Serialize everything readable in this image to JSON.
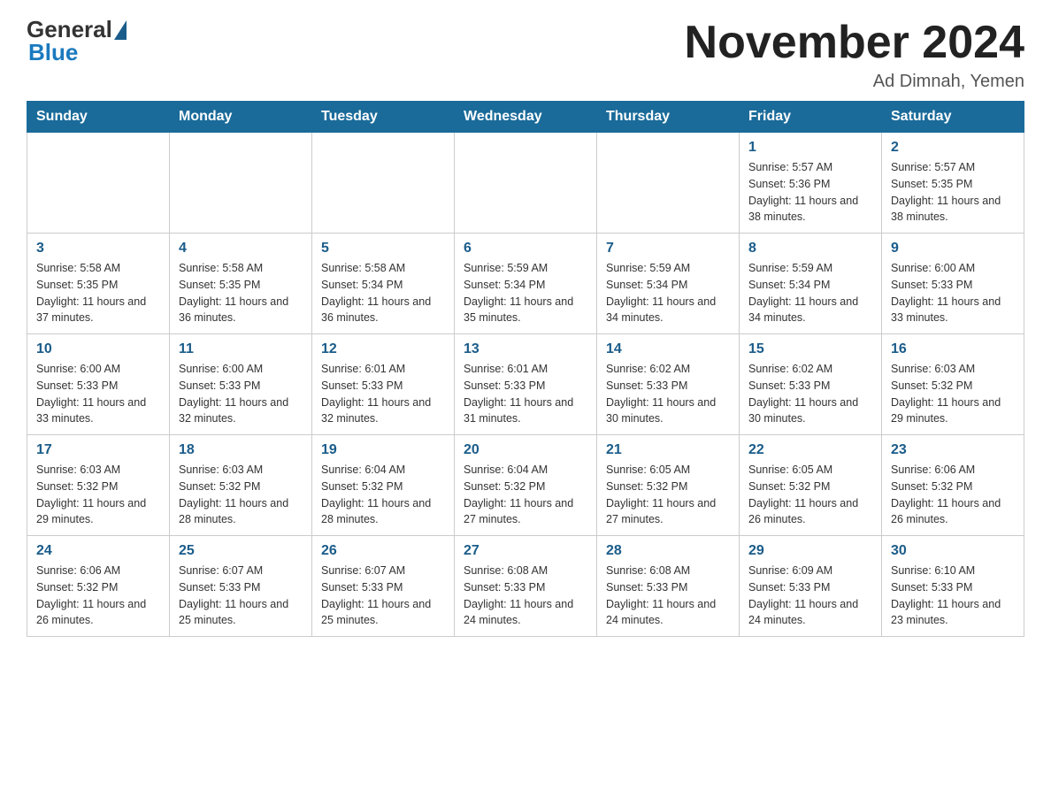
{
  "header": {
    "logo_general": "General",
    "logo_blue": "Blue",
    "month_title": "November 2024",
    "location": "Ad Dimnah, Yemen"
  },
  "weekdays": [
    "Sunday",
    "Monday",
    "Tuesday",
    "Wednesday",
    "Thursday",
    "Friday",
    "Saturday"
  ],
  "weeks": [
    [
      {
        "day": "",
        "info": ""
      },
      {
        "day": "",
        "info": ""
      },
      {
        "day": "",
        "info": ""
      },
      {
        "day": "",
        "info": ""
      },
      {
        "day": "",
        "info": ""
      },
      {
        "day": "1",
        "info": "Sunrise: 5:57 AM\nSunset: 5:36 PM\nDaylight: 11 hours and 38 minutes."
      },
      {
        "day": "2",
        "info": "Sunrise: 5:57 AM\nSunset: 5:35 PM\nDaylight: 11 hours and 38 minutes."
      }
    ],
    [
      {
        "day": "3",
        "info": "Sunrise: 5:58 AM\nSunset: 5:35 PM\nDaylight: 11 hours and 37 minutes."
      },
      {
        "day": "4",
        "info": "Sunrise: 5:58 AM\nSunset: 5:35 PM\nDaylight: 11 hours and 36 minutes."
      },
      {
        "day": "5",
        "info": "Sunrise: 5:58 AM\nSunset: 5:34 PM\nDaylight: 11 hours and 36 minutes."
      },
      {
        "day": "6",
        "info": "Sunrise: 5:59 AM\nSunset: 5:34 PM\nDaylight: 11 hours and 35 minutes."
      },
      {
        "day": "7",
        "info": "Sunrise: 5:59 AM\nSunset: 5:34 PM\nDaylight: 11 hours and 34 minutes."
      },
      {
        "day": "8",
        "info": "Sunrise: 5:59 AM\nSunset: 5:34 PM\nDaylight: 11 hours and 34 minutes."
      },
      {
        "day": "9",
        "info": "Sunrise: 6:00 AM\nSunset: 5:33 PM\nDaylight: 11 hours and 33 minutes."
      }
    ],
    [
      {
        "day": "10",
        "info": "Sunrise: 6:00 AM\nSunset: 5:33 PM\nDaylight: 11 hours and 33 minutes."
      },
      {
        "day": "11",
        "info": "Sunrise: 6:00 AM\nSunset: 5:33 PM\nDaylight: 11 hours and 32 minutes."
      },
      {
        "day": "12",
        "info": "Sunrise: 6:01 AM\nSunset: 5:33 PM\nDaylight: 11 hours and 32 minutes."
      },
      {
        "day": "13",
        "info": "Sunrise: 6:01 AM\nSunset: 5:33 PM\nDaylight: 11 hours and 31 minutes."
      },
      {
        "day": "14",
        "info": "Sunrise: 6:02 AM\nSunset: 5:33 PM\nDaylight: 11 hours and 30 minutes."
      },
      {
        "day": "15",
        "info": "Sunrise: 6:02 AM\nSunset: 5:33 PM\nDaylight: 11 hours and 30 minutes."
      },
      {
        "day": "16",
        "info": "Sunrise: 6:03 AM\nSunset: 5:32 PM\nDaylight: 11 hours and 29 minutes."
      }
    ],
    [
      {
        "day": "17",
        "info": "Sunrise: 6:03 AM\nSunset: 5:32 PM\nDaylight: 11 hours and 29 minutes."
      },
      {
        "day": "18",
        "info": "Sunrise: 6:03 AM\nSunset: 5:32 PM\nDaylight: 11 hours and 28 minutes."
      },
      {
        "day": "19",
        "info": "Sunrise: 6:04 AM\nSunset: 5:32 PM\nDaylight: 11 hours and 28 minutes."
      },
      {
        "day": "20",
        "info": "Sunrise: 6:04 AM\nSunset: 5:32 PM\nDaylight: 11 hours and 27 minutes."
      },
      {
        "day": "21",
        "info": "Sunrise: 6:05 AM\nSunset: 5:32 PM\nDaylight: 11 hours and 27 minutes."
      },
      {
        "day": "22",
        "info": "Sunrise: 6:05 AM\nSunset: 5:32 PM\nDaylight: 11 hours and 26 minutes."
      },
      {
        "day": "23",
        "info": "Sunrise: 6:06 AM\nSunset: 5:32 PM\nDaylight: 11 hours and 26 minutes."
      }
    ],
    [
      {
        "day": "24",
        "info": "Sunrise: 6:06 AM\nSunset: 5:32 PM\nDaylight: 11 hours and 26 minutes."
      },
      {
        "day": "25",
        "info": "Sunrise: 6:07 AM\nSunset: 5:33 PM\nDaylight: 11 hours and 25 minutes."
      },
      {
        "day": "26",
        "info": "Sunrise: 6:07 AM\nSunset: 5:33 PM\nDaylight: 11 hours and 25 minutes."
      },
      {
        "day": "27",
        "info": "Sunrise: 6:08 AM\nSunset: 5:33 PM\nDaylight: 11 hours and 24 minutes."
      },
      {
        "day": "28",
        "info": "Sunrise: 6:08 AM\nSunset: 5:33 PM\nDaylight: 11 hours and 24 minutes."
      },
      {
        "day": "29",
        "info": "Sunrise: 6:09 AM\nSunset: 5:33 PM\nDaylight: 11 hours and 24 minutes."
      },
      {
        "day": "30",
        "info": "Sunrise: 6:10 AM\nSunset: 5:33 PM\nDaylight: 11 hours and 23 minutes."
      }
    ]
  ]
}
